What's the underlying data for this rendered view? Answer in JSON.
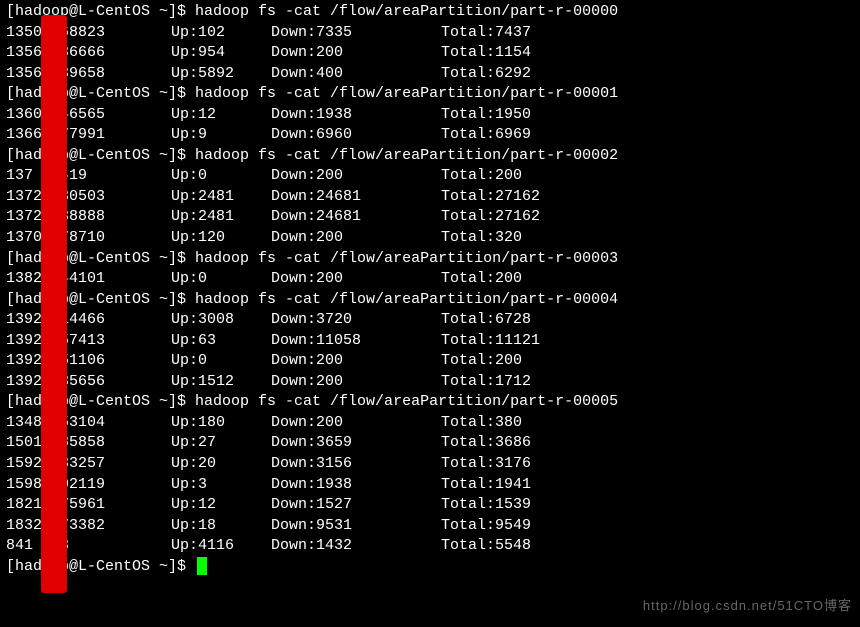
{
  "prompt": "[hadoop@L-CentOS ~]$ ",
  "commands": [
    {
      "cmd": "hadoop fs -cat /flow/areaPartition/part-r-00000"
    },
    {
      "cmd": "hadoop fs -cat /flow/areaPartition/part-r-00001"
    },
    {
      "cmd": "hadoop fs -cat /flow/areaPartition/part-r-00002"
    },
    {
      "cmd": "hadoop fs -cat /flow/areaPartition/part-r-00003"
    },
    {
      "cmd": "hadoop fs -cat /flow/areaPartition/part-r-00004"
    },
    {
      "cmd": "hadoop fs -cat /flow/areaPartition/part-r-00005"
    }
  ],
  "outputs": [
    [
      {
        "phone": "1350 468823",
        "up": "Up:102",
        "down": "Down:7335",
        "total": "Total:7437"
      },
      {
        "phone": "1356 436666",
        "up": "Up:954",
        "down": "Down:200",
        "total": "Total:1154"
      },
      {
        "phone": "1356 439658",
        "up": "Up:5892",
        "down": "Down:400",
        "total": "Total:6292"
      }
    ],
    [
      {
        "phone": "1360 846565",
        "up": "Up:12",
        "down": "Down:1938",
        "total": "Total:1950"
      },
      {
        "phone": "1366 577991",
        "up": "Up:9",
        "down": "Down:6960",
        "total": "Total:6969"
      }
    ],
    [
      {
        "phone": "137  99419",
        "up": "Up:0",
        "down": "Down:200",
        "total": "Total:200"
      },
      {
        "phone": "1372 230503",
        "up": "Up:2481",
        "down": "Down:24681",
        "total": "Total:27162"
      },
      {
        "phone": "1372 238888",
        "up": "Up:2481",
        "down": "Down:24681",
        "total": "Total:27162"
      },
      {
        "phone": "1370 778710",
        "up": "Up:120",
        "down": "Down:200",
        "total": "Total:320"
      }
    ],
    [
      {
        "phone": "1382 544101",
        "up": "Up:0",
        "down": "Down:200",
        "total": "Total:200"
      }
    ],
    [
      {
        "phone": "1392 814466",
        "up": "Up:3008",
        "down": "Down:3720",
        "total": "Total:6728"
      },
      {
        "phone": "1392 057413",
        "up": "Up:63",
        "down": "Down:11058",
        "total": "Total:11121"
      },
      {
        "phone": "1392 251106",
        "up": "Up:0",
        "down": "Down:200",
        "total": "Total:200"
      },
      {
        "phone": "1392 435656",
        "up": "Up:1512",
        "down": "Down:200",
        "total": "Total:1712"
      }
    ],
    [
      {
        "phone": "1348 253104",
        "up": "Up:180",
        "down": "Down:200",
        "total": "Total:380"
      },
      {
        "phone": "1501 685858",
        "up": "Up:27",
        "down": "Down:3659",
        "total": "Total:3686"
      },
      {
        "phone": "1592 133257",
        "up": "Up:20",
        "down": "Down:3156",
        "total": "Total:3176"
      },
      {
        "phone": "1598 002119",
        "up": "Up:3",
        "down": "Down:1938",
        "total": "Total:1941"
      },
      {
        "phone": "1821 575961",
        "up": "Up:12",
        "down": "Down:1527",
        "total": "Total:1539"
      },
      {
        "phone": "1832 173382",
        "up": "Up:18",
        "down": "Down:9531",
        "total": "Total:9549"
      },
      {
        "phone": "841  413",
        "up": "Up:4116",
        "down": "Down:1432",
        "total": "Total:5548"
      }
    ]
  ],
  "watermark": "http://blog.csdn.net/51CTO博客"
}
